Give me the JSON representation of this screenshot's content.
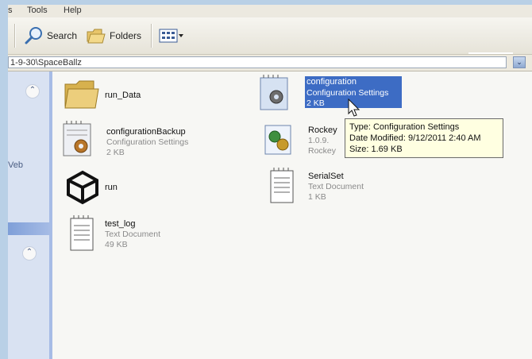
{
  "menu": {
    "items": [
      "s",
      "Tools",
      "Help"
    ]
  },
  "toolbar": {
    "search_label": "Search",
    "folders_label": "Folders"
  },
  "address": {
    "path": "1-9-30\\SpaceBallz",
    "dropdown_glyph": "⌄"
  },
  "left_pane": {
    "web_label": "Veb"
  },
  "files": [
    {
      "name": "run_Data",
      "type": "",
      "size": "",
      "icon": "folder-icon"
    },
    {
      "name": "configuration",
      "type": "Configuration Settings",
      "size": "2 KB",
      "icon": "config-file-icon",
      "selected": true
    },
    {
      "name": "configurationBackup",
      "type": "Configuration Settings",
      "size": "2 KB",
      "icon": "config-file-icon"
    },
    {
      "name": "Rockey",
      "type": "1.0.9.",
      "size": "Rockey",
      "icon": "gear-app-icon"
    },
    {
      "name": "run",
      "type": "",
      "size": "",
      "icon": "unity-icon"
    },
    {
      "name": "SerialSet",
      "type": "Text Document",
      "size": "1 KB",
      "icon": "text-file-icon"
    },
    {
      "name": "test_log",
      "type": "Text Document",
      "size": "49 KB",
      "icon": "text-file-icon"
    }
  ],
  "tooltip": {
    "type_line": "Type: Configuration Settings",
    "date_line": "Date Modified: 9/12/2011 2:40 AM",
    "size_line": "Size: 1.69 KB"
  },
  "colors": {
    "selection": "#3d6cc4",
    "tooltip_bg": "#ffffe1",
    "task_pane": "#7f9fd8"
  }
}
